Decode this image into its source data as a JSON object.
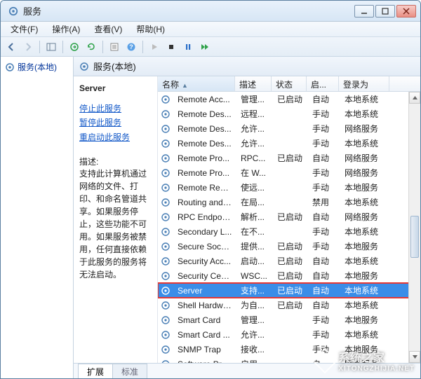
{
  "window": {
    "title": "服务"
  },
  "menubar": {
    "file": "文件(F)",
    "action": "操作(A)",
    "view": "查看(V)",
    "help": "帮助(H)"
  },
  "tree": {
    "root": "服务(本地)"
  },
  "subheader": {
    "title": "服务(本地)"
  },
  "detail": {
    "selected_name": "Server",
    "links": {
      "stop": "停止此服务",
      "pause": "暂停此服务",
      "restart": "重启动此服务"
    },
    "desc_label": "描述:",
    "desc_text": "支持此计算机通过网络的文件、打印、和命名管道共享。如果服务停止，这些功能不可用。如果服务被禁用，任何直接依赖于此服务的服务将无法启动。"
  },
  "columns": {
    "name": "名称",
    "desc": "描述",
    "status": "状态",
    "start": "启...",
    "login": "登录为"
  },
  "services": [
    {
      "name": "Remote Acc...",
      "desc": "管理...",
      "status": "已启动",
      "start": "自动",
      "login": "本地系统"
    },
    {
      "name": "Remote Des...",
      "desc": "远程...",
      "status": "",
      "start": "手动",
      "login": "本地系统"
    },
    {
      "name": "Remote Des...",
      "desc": "允许...",
      "status": "",
      "start": "手动",
      "login": "网络服务"
    },
    {
      "name": "Remote Des...",
      "desc": "允许...",
      "status": "",
      "start": "手动",
      "login": "本地系统"
    },
    {
      "name": "Remote Pro...",
      "desc": "RPC...",
      "status": "已启动",
      "start": "自动",
      "login": "网络服务"
    },
    {
      "name": "Remote Pro...",
      "desc": "在 W...",
      "status": "",
      "start": "手动",
      "login": "网络服务"
    },
    {
      "name": "Remote Regi...",
      "desc": "使远...",
      "status": "",
      "start": "手动",
      "login": "本地服务"
    },
    {
      "name": "Routing and ...",
      "desc": "在局...",
      "status": "",
      "start": "禁用",
      "login": "本地系统"
    },
    {
      "name": "RPC Endpoin...",
      "desc": "解析...",
      "status": "已启动",
      "start": "自动",
      "login": "网络服务"
    },
    {
      "name": "Secondary L...",
      "desc": "在不...",
      "status": "",
      "start": "手动",
      "login": "本地系统"
    },
    {
      "name": "Secure Sock...",
      "desc": "提供...",
      "status": "已启动",
      "start": "手动",
      "login": "本地服务"
    },
    {
      "name": "Security Acc...",
      "desc": "启动...",
      "status": "已启动",
      "start": "自动",
      "login": "本地系统"
    },
    {
      "name": "Security Cent...",
      "desc": "WSC...",
      "status": "已启动",
      "start": "自动",
      "login": "本地服务"
    },
    {
      "name": "Server",
      "desc": "支持...",
      "status": "已启动",
      "start": "自动",
      "login": "本地系统",
      "selected": true,
      "highlighted": true
    },
    {
      "name": "Shell Hardwa...",
      "desc": "为自...",
      "status": "已启动",
      "start": "自动",
      "login": "本地系统"
    },
    {
      "name": "Smart Card",
      "desc": "管理...",
      "status": "",
      "start": "手动",
      "login": "本地服务"
    },
    {
      "name": "Smart Card ...",
      "desc": "允许...",
      "status": "",
      "start": "手动",
      "login": "本地系统"
    },
    {
      "name": "SNMP Trap",
      "desc": "接收...",
      "status": "",
      "start": "手动",
      "login": "本地服务"
    },
    {
      "name": "Software Pro...",
      "desc": "启用...",
      "status": "",
      "start": "自...",
      "login": "网络服务"
    }
  ],
  "footer_tabs": {
    "extended": "扩展",
    "standard": "标准"
  },
  "watermark": {
    "name": "系统之家",
    "sub": "XITONGZHIJIA.NET"
  }
}
